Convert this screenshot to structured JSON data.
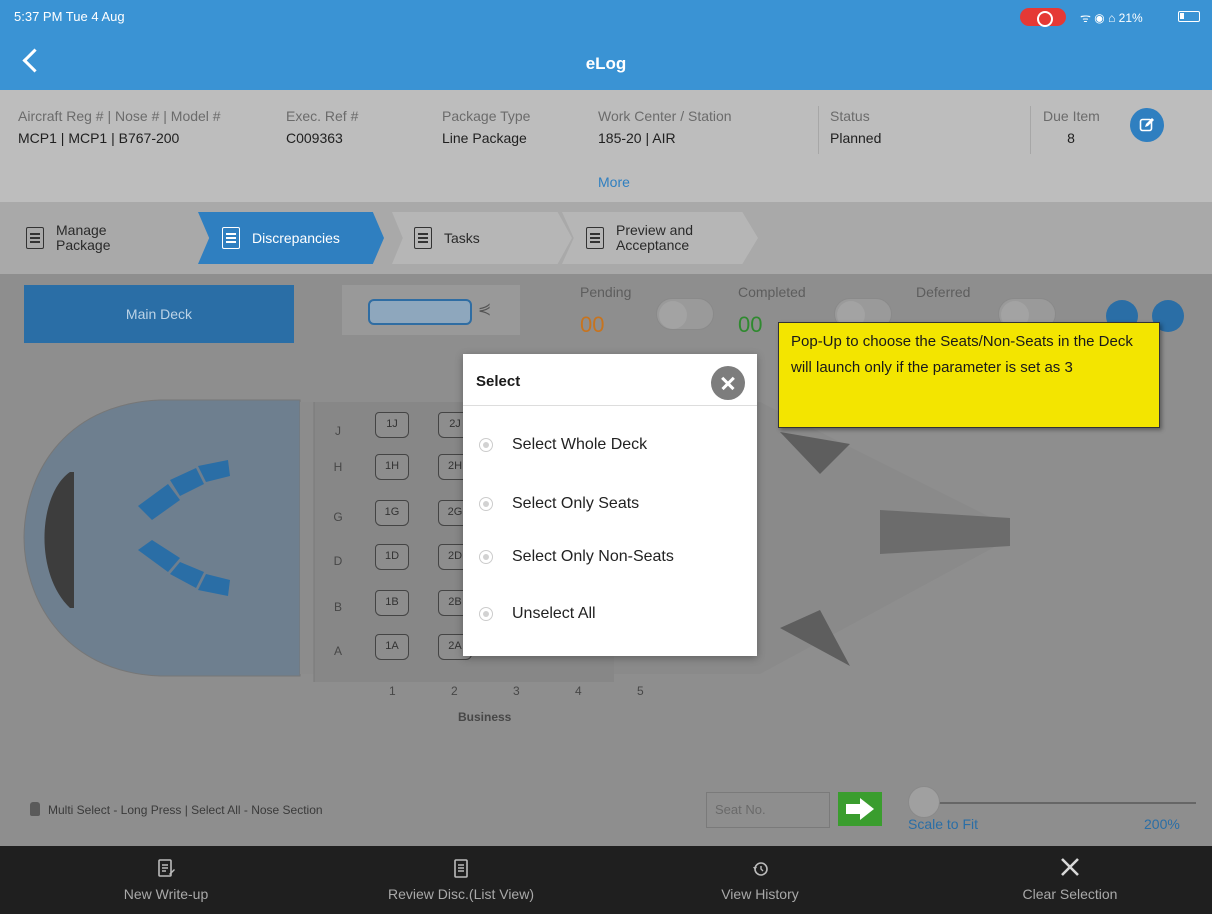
{
  "status_bar": {
    "time": "5:37 PM  Tue 4 Aug",
    "system_right": "ᯤ ◉ ⌂ 21%"
  },
  "app": {
    "title": "eLog"
  },
  "info": {
    "aircraft_label": "Aircraft Reg # | Nose # | Model #",
    "aircraft_value": "MCP1 | MCP1 | B767-200",
    "exec_label": "Exec. Ref #",
    "exec_value": "C009363",
    "package_label": "Package Type",
    "package_value": "Line Package",
    "workcenter_label": "Work Center / Station",
    "workcenter_value": "185-20 | AIR",
    "more": "More",
    "status_label": "Status",
    "status_value": "Planned",
    "due_label": "Due Item",
    "due_value": "8"
  },
  "steps": [
    {
      "label_line1": "Manage",
      "label_line2": "Package"
    },
    {
      "label_line1": "Discrepancies",
      "label_line2": ""
    },
    {
      "label_line1": "Tasks",
      "label_line2": ""
    },
    {
      "label_line1": "Preview and",
      "label_line2": "Acceptance"
    }
  ],
  "deck": {
    "button": "Main Deck",
    "pending_label": "Pending",
    "pending_value": "00",
    "completed_label": "Completed",
    "completed_value": "00",
    "deferred_label": "Deferred",
    "rows": [
      "J",
      "H",
      "G",
      "D",
      "B",
      "A"
    ],
    "seats_col1": [
      "1J",
      "1H",
      "1G",
      "1D",
      "1B",
      "1A"
    ],
    "seats_col2": [
      "2J",
      "2H",
      "2G",
      "2D",
      "2B",
      "2A"
    ],
    "columns": [
      "1",
      "2",
      "3",
      "4",
      "5"
    ],
    "section": "Business"
  },
  "colors": {
    "pending": "#c7741f",
    "completed": "#2f8a2f"
  },
  "dialog": {
    "title": "Select",
    "options": [
      "Select Whole Deck",
      "Select Only Seats",
      "Select Only Non-Seats",
      "Unselect All"
    ]
  },
  "callout": {
    "text": "Pop-Up to choose the Seats/Non-Seats in the Deck will launch only if the parameter is set as 3"
  },
  "footer": {
    "hint": "Multi Select - Long Press | Select All - Nose Section",
    "seat_placeholder": "Seat No.",
    "scale_label": "Scale to Fit",
    "zoom_label": "200%"
  },
  "toolbar": [
    {
      "label": "New Write-up",
      "icon": "new-writeup-icon"
    },
    {
      "label": "Review Disc.(List View)",
      "icon": "list-icon"
    },
    {
      "label": "View History",
      "icon": "history-icon"
    },
    {
      "label": "Clear Selection",
      "icon": "close-icon"
    }
  ]
}
